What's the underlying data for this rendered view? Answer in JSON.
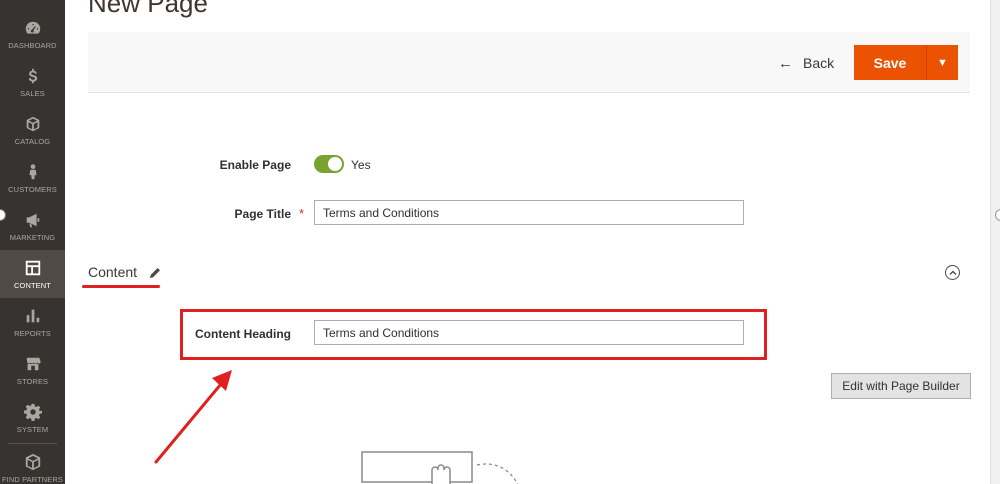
{
  "header": {
    "title": "New Page",
    "back_label": "Back",
    "save_label": "Save"
  },
  "sidebar": {
    "items": [
      {
        "label": "DASHBOARD",
        "icon": "dashboard-icon"
      },
      {
        "label": "SALES",
        "icon": "dollar-icon"
      },
      {
        "label": "CATALOG",
        "icon": "box-icon"
      },
      {
        "label": "CUSTOMERS",
        "icon": "person-icon"
      },
      {
        "label": "MARKETING",
        "icon": "megaphone-icon"
      },
      {
        "label": "CONTENT",
        "icon": "layout-icon",
        "active": true
      },
      {
        "label": "REPORTS",
        "icon": "bar-chart-icon"
      },
      {
        "label": "STORES",
        "icon": "storefront-icon"
      },
      {
        "label": "SYSTEM",
        "icon": "gear-icon"
      },
      {
        "label": "FIND PARTNERS",
        "icon": "cube-icon"
      }
    ]
  },
  "form": {
    "enable_page": {
      "label": "Enable Page",
      "value": "Yes",
      "enabled": true
    },
    "page_title": {
      "label": "Page Title",
      "required_mark": "*",
      "value": "Terms and Conditions"
    }
  },
  "content_section": {
    "title": "Content",
    "content_heading": {
      "label": "Content Heading",
      "value": "Terms and Conditions"
    },
    "page_builder_button": "Edit with Page Builder"
  },
  "colors": {
    "accent": "#eb5202",
    "sidebar": "#373330",
    "toggle_on": "#79a22e",
    "annotation": "#e02020"
  }
}
